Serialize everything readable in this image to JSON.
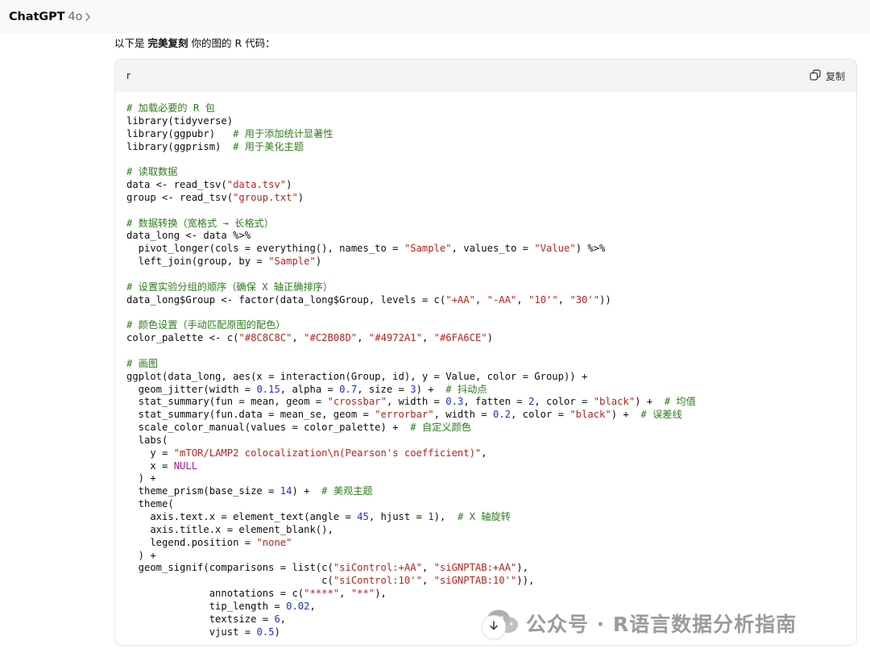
{
  "header": {
    "model_name": "ChatGPT",
    "model_version": "4o"
  },
  "message": {
    "intro_before": "以下是 ",
    "intro_bold": "完美复刻",
    "intro_after": " 你的图的 R 代码："
  },
  "code_block": {
    "language": "r",
    "copy_label": "复制",
    "lines": [
      [
        [
          "c",
          "# 加载必要的 R 包"
        ]
      ],
      [
        [
          "p",
          "library(tidyverse)"
        ]
      ],
      [
        [
          "p",
          "library(ggpubr)   "
        ],
        [
          "c",
          "# 用于添加统计显著性"
        ]
      ],
      [
        [
          "p",
          "library(ggprism)  "
        ],
        [
          "c",
          "# 用于美化主题"
        ]
      ],
      [],
      [
        [
          "c",
          "# 读取数据"
        ]
      ],
      [
        [
          "p",
          "data <- read_tsv("
        ],
        [
          "s",
          "\"data.tsv\""
        ],
        [
          "p",
          ")"
        ]
      ],
      [
        [
          "p",
          "group <- read_tsv("
        ],
        [
          "s",
          "\"group.txt\""
        ],
        [
          "p",
          ")"
        ]
      ],
      [],
      [
        [
          "c",
          "# 数据转换（宽格式 → 长格式）"
        ]
      ],
      [
        [
          "p",
          "data_long <- data %>%"
        ]
      ],
      [
        [
          "p",
          "  pivot_longer(cols = everything(), names_to = "
        ],
        [
          "s",
          "\"Sample\""
        ],
        [
          "p",
          ", values_to = "
        ],
        [
          "s",
          "\"Value\""
        ],
        [
          "p",
          ") %>%"
        ]
      ],
      [
        [
          "p",
          "  left_join(group, by = "
        ],
        [
          "s",
          "\"Sample\""
        ],
        [
          "p",
          ")"
        ]
      ],
      [],
      [
        [
          "c",
          "# 设置实验分组的顺序（确保 X 轴正确排序）"
        ]
      ],
      [
        [
          "p",
          "data_long$Group <- factor(data_long$Group, levels = c("
        ],
        [
          "s",
          "\"+AA\""
        ],
        [
          "p",
          ", "
        ],
        [
          "s",
          "\"-AA\""
        ],
        [
          "p",
          ", "
        ],
        [
          "s",
          "\"10'\""
        ],
        [
          "p",
          ", "
        ],
        [
          "s",
          "\"30'\""
        ],
        [
          "p",
          "))"
        ]
      ],
      [],
      [
        [
          "c",
          "# 颜色设置（手动匹配原图的配色）"
        ]
      ],
      [
        [
          "p",
          "color_palette <- c("
        ],
        [
          "s",
          "\"#8C8C8C\""
        ],
        [
          "p",
          ", "
        ],
        [
          "s",
          "\"#C2B08D\""
        ],
        [
          "p",
          ", "
        ],
        [
          "s",
          "\"#4972A1\""
        ],
        [
          "p",
          ", "
        ],
        [
          "s",
          "\"#6FA6CE\""
        ],
        [
          "p",
          ")"
        ]
      ],
      [],
      [
        [
          "c",
          "# 画图"
        ]
      ],
      [
        [
          "p",
          "ggplot(data_long, aes(x = interaction(Group, id), y = Value, color = Group)) +"
        ]
      ],
      [
        [
          "p",
          "  geom_jitter(width = "
        ],
        [
          "n",
          "0.15"
        ],
        [
          "p",
          ", alpha = "
        ],
        [
          "n",
          "0.7"
        ],
        [
          "p",
          ", size = "
        ],
        [
          "n",
          "3"
        ],
        [
          "p",
          ") +  "
        ],
        [
          "c",
          "# 抖动点"
        ]
      ],
      [
        [
          "p",
          "  stat_summary(fun = mean, geom = "
        ],
        [
          "s",
          "\"crossbar\""
        ],
        [
          "p",
          ", width = "
        ],
        [
          "n",
          "0.3"
        ],
        [
          "p",
          ", fatten = "
        ],
        [
          "n",
          "2"
        ],
        [
          "p",
          ", color = "
        ],
        [
          "s",
          "\"black\""
        ],
        [
          "p",
          ") +  "
        ],
        [
          "c",
          "# 均值"
        ]
      ],
      [
        [
          "p",
          "  stat_summary(fun.data = mean_se, geom = "
        ],
        [
          "s",
          "\"errorbar\""
        ],
        [
          "p",
          ", width = "
        ],
        [
          "n",
          "0.2"
        ],
        [
          "p",
          ", color = "
        ],
        [
          "s",
          "\"black\""
        ],
        [
          "p",
          ") +  "
        ],
        [
          "c",
          "# 误差线"
        ]
      ],
      [
        [
          "p",
          "  scale_color_manual(values = color_palette) +  "
        ],
        [
          "c",
          "# 自定义颜色"
        ]
      ],
      [
        [
          "p",
          "  labs("
        ]
      ],
      [
        [
          "p",
          "    y = "
        ],
        [
          "s",
          "\"mTOR/LAMP2 colocalization\\n(Pearson's coefficient)\""
        ],
        [
          "p",
          ","
        ]
      ],
      [
        [
          "p",
          "    x = "
        ],
        [
          "k",
          "NULL"
        ]
      ],
      [
        [
          "p",
          "  ) +"
        ]
      ],
      [
        [
          "p",
          "  theme_prism(base_size = "
        ],
        [
          "n",
          "14"
        ],
        [
          "p",
          ") +  "
        ],
        [
          "c",
          "# 美观主题"
        ]
      ],
      [
        [
          "p",
          "  theme("
        ]
      ],
      [
        [
          "p",
          "    axis.text.x = element_text(angle = "
        ],
        [
          "n",
          "45"
        ],
        [
          "p",
          ", hjust = "
        ],
        [
          "n",
          "1"
        ],
        [
          "p",
          "),  "
        ],
        [
          "c",
          "# X 轴旋转"
        ]
      ],
      [
        [
          "p",
          "    axis.title.x = element_blank(),"
        ]
      ],
      [
        [
          "p",
          "    legend.position = "
        ],
        [
          "s",
          "\"none\""
        ]
      ],
      [
        [
          "p",
          "  ) +"
        ]
      ],
      [
        [
          "p",
          "  geom_signif(comparisons = list(c("
        ],
        [
          "s",
          "\"siControl:+AA\""
        ],
        [
          "p",
          ", "
        ],
        [
          "s",
          "\"siGNPTAB:+AA\""
        ],
        [
          "p",
          "),"
        ]
      ],
      [
        [
          "p",
          "                                 c("
        ],
        [
          "s",
          "\"siControl:10'\""
        ],
        [
          "p",
          ", "
        ],
        [
          "s",
          "\"siGNPTAB:10'\""
        ],
        [
          "p",
          ")),"
        ]
      ],
      [
        [
          "p",
          "              annotations = c("
        ],
        [
          "s",
          "\"****\""
        ],
        [
          "p",
          ", "
        ],
        [
          "s",
          "\"**\""
        ],
        [
          "p",
          "),"
        ]
      ],
      [
        [
          "p",
          "              tip_length = "
        ],
        [
          "n",
          "0.02"
        ],
        [
          "p",
          ","
        ]
      ],
      [
        [
          "p",
          "              textsize = "
        ],
        [
          "n",
          "6"
        ],
        [
          "p",
          ","
        ]
      ],
      [
        [
          "p",
          "              vjust = "
        ],
        [
          "n",
          "0.5"
        ],
        [
          "p",
          ")"
        ]
      ]
    ]
  },
  "watermark": {
    "text": "公众号 · R语言数据分析指南"
  },
  "icons": {
    "chevron": "chevron-right-icon",
    "copy": "copy-icon",
    "wechat": "wechat-icon",
    "scroll": "arrow-down-icon"
  },
  "colors": {
    "comment": "#2e7d1e",
    "string": "#b5241c",
    "number": "#1c2fd1",
    "keyword": "#a31aa3",
    "header_bg": "#f9f9f9",
    "code_header_bg": "#f4f4f4"
  }
}
